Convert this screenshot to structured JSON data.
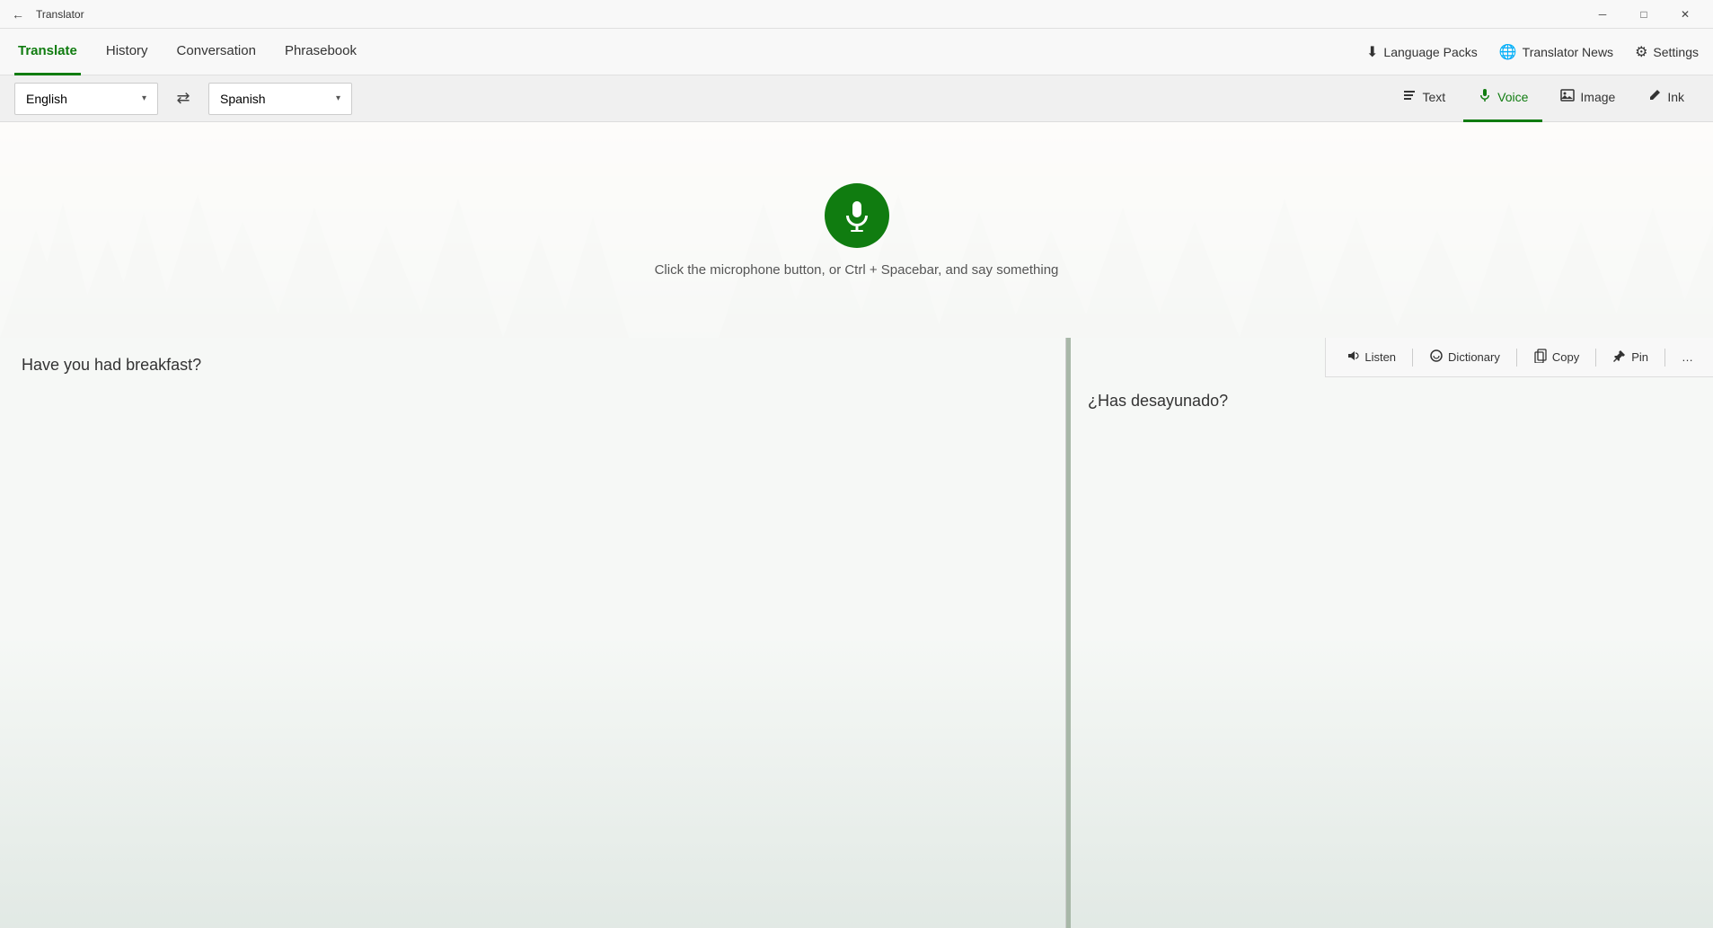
{
  "titleBar": {
    "title": "Translator",
    "backIcon": "←",
    "minimizeIcon": "─",
    "maximizeIcon": "□",
    "closeIcon": "✕"
  },
  "nav": {
    "tabs": [
      {
        "id": "translate",
        "label": "Translate",
        "active": true
      },
      {
        "id": "history",
        "label": "History",
        "active": false
      },
      {
        "id": "conversation",
        "label": "Conversation",
        "active": false
      },
      {
        "id": "phrasebook",
        "label": "Phrasebook",
        "active": false
      }
    ],
    "rightItems": [
      {
        "id": "language-packs",
        "label": "Language Packs",
        "icon": "⬇"
      },
      {
        "id": "translator-news",
        "label": "Translator News",
        "icon": "🌐"
      },
      {
        "id": "settings",
        "label": "Settings",
        "icon": "⚙"
      }
    ]
  },
  "langBar": {
    "sourceLang": "English",
    "targetLang": "Spanish",
    "swapIcon": "⇄",
    "modes": [
      {
        "id": "text",
        "label": "Text",
        "icon": "📄",
        "active": false
      },
      {
        "id": "voice",
        "label": "Voice",
        "icon": "🎙",
        "active": true
      },
      {
        "id": "image",
        "label": "Image",
        "icon": "🖼",
        "active": false
      },
      {
        "id": "ink",
        "label": "Ink",
        "icon": "✏",
        "active": false
      }
    ]
  },
  "voiceArea": {
    "hint": "Click the microphone button, or Ctrl + Spacebar, and say something"
  },
  "toolbar": {
    "listenLabel": "Listen",
    "dictionaryLabel": "Dictionary",
    "copyLabel": "Copy",
    "pinLabel": "Pin",
    "moreLabel": "…"
  },
  "sourcePanel": {
    "text": "Have you had breakfast?"
  },
  "targetPanel": {
    "text": "¿Has desayunado?"
  }
}
